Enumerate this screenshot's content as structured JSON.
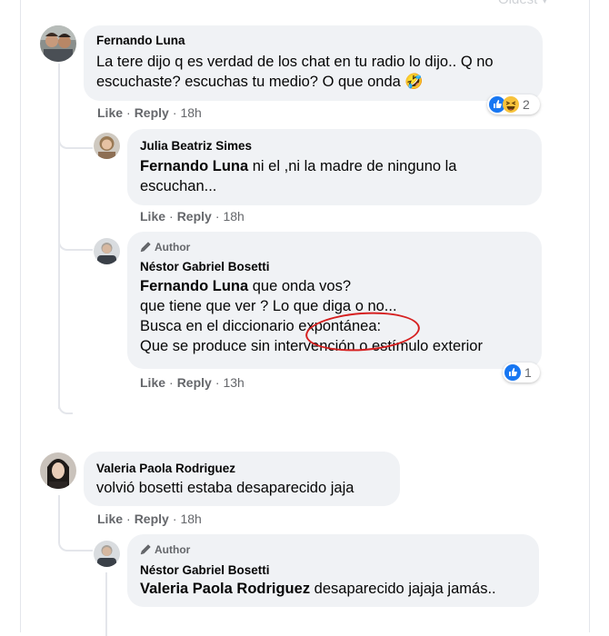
{
  "sort_label": "Oldest ▾",
  "comments": [
    {
      "name": "Fernando Luna",
      "text": "La tere dijo q es verdad de los chat en tu radio lo dijo.. Q no escuchaste? escuchas tu medio? O que onda 🤣",
      "like": "Like",
      "reply": "Reply",
      "time": "18h",
      "reaction_count": "2",
      "reaction_icons": [
        "like-icon",
        "haha-icon"
      ]
    },
    {
      "name": "Julia Beatriz Simes",
      "mention": "Fernando Luna",
      "text": " ni el ,ni la madre de ninguno la escuchan...",
      "like": "Like",
      "reply": "Reply",
      "time": "18h"
    },
    {
      "badge": "Author",
      "name": "Néstor Gabriel Bosetti",
      "mention": "Fernando Luna",
      "line1": " que onda vos?",
      "line2": "que tiene que ver ? Lo que diga o no...",
      "line3": "Busca en el diccionario expontánea:",
      "line4": "Que se produce sin intervención o estímulo exterior",
      "like": "Like",
      "reply": "Reply",
      "time": "13h",
      "reaction_count": "1",
      "reaction_icons": [
        "like-icon"
      ]
    },
    {
      "name": "Valeria Paola Rodriguez",
      "text": "volvió bosetti estaba desaparecido jaja",
      "like": "Like",
      "reply": "Reply",
      "time": "18h"
    },
    {
      "badge": "Author",
      "name": "Néstor Gabriel Bosetti",
      "mention": "Valeria Paola Rodriguez",
      "text": " desaparecido jajaja jamás..",
      "like": "Like",
      "reply": "Reply"
    }
  ],
  "colors": {
    "bubble": "#f0f2f5",
    "secondary_text": "#65676b",
    "like_blue": "#1877f2",
    "annotation_red": "#d62020"
  }
}
